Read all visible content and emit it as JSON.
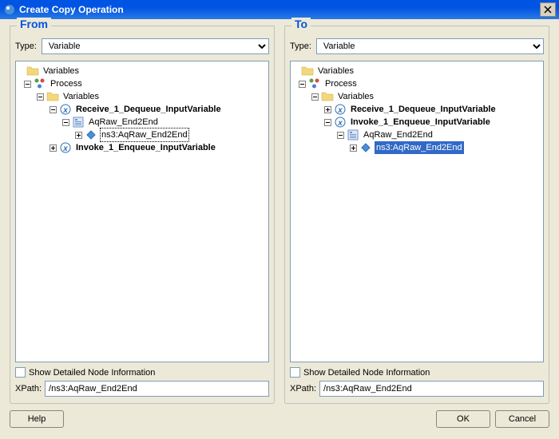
{
  "title": "Create Copy Operation",
  "from": {
    "header": "From",
    "typeLabel": "Type:",
    "typeValue": "Variable",
    "tree": {
      "root": "Variables",
      "process": "Process",
      "varsInner": "Variables",
      "receive": "Receive_1_Dequeue_InputVariable",
      "aq": "AqRaw_End2End",
      "ns3": "ns3:AqRaw_End2End",
      "invoke": "Invoke_1_Enqueue_InputVariable"
    },
    "showDetail": "Show Detailed Node Information",
    "xpathLabel": "XPath:",
    "xpathValue": "/ns3:AqRaw_End2End"
  },
  "to": {
    "header": "To",
    "typeLabel": "Type:",
    "typeValue": "Variable",
    "tree": {
      "root": "Variables",
      "process": "Process",
      "varsInner": "Variables",
      "receive": "Receive_1_Dequeue_InputVariable",
      "invoke": "Invoke_1_Enqueue_InputVariable",
      "aq": "AqRaw_End2End",
      "ns3": "ns3:AqRaw_End2End"
    },
    "showDetail": "Show Detailed Node Information",
    "xpathLabel": "XPath:",
    "xpathValue": "/ns3:AqRaw_End2End"
  },
  "buttons": {
    "help": "Help",
    "ok": "OK",
    "cancel": "Cancel"
  }
}
